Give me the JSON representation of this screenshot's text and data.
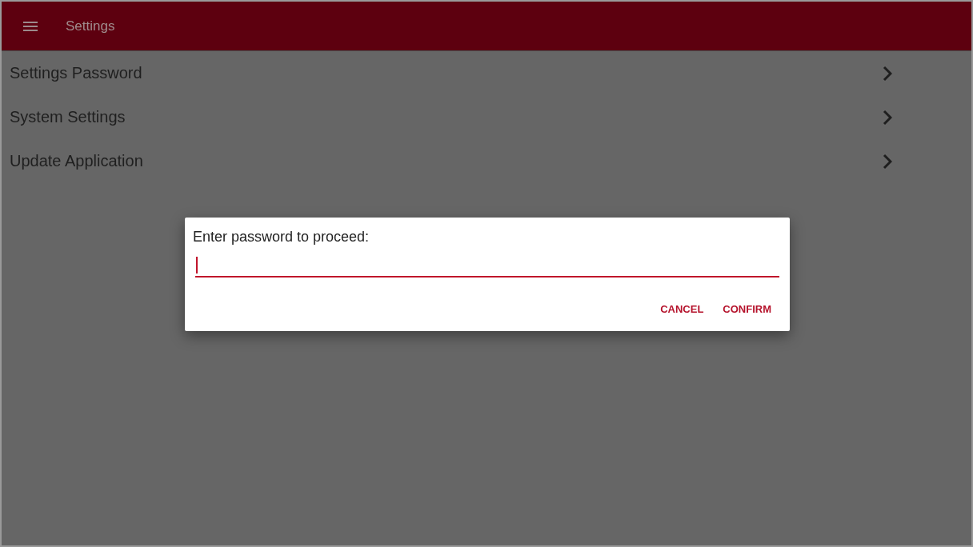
{
  "app_bar": {
    "title": "Settings"
  },
  "menu_items": [
    {
      "label": "Settings Password"
    },
    {
      "label": "System Settings"
    },
    {
      "label": "Update Application"
    }
  ],
  "dialog": {
    "message": "Enter password to proceed:",
    "input": {
      "focused": true
    },
    "buttons": [
      {
        "label": "CANCEL"
      },
      {
        "label": "CONFIRM"
      }
    ]
  }
}
